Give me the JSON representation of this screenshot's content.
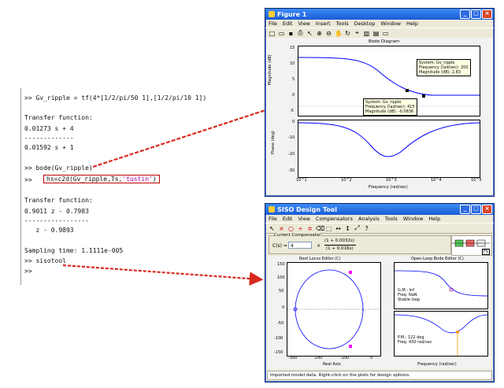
{
  "console": {
    "lines": [
      ">> Gv_ripple = tf(4*[1/2/pi/50 1],[1/2/pi/10 1])",
      "Transfer function:",
      "0.01273 s + 4",
      "-------------",
      "0.01592 s + 1",
      ">> bode(Gv_ripple)",
      ">> hs=c2d(Gv_ripple,Ts,'tustin')",
      "Transfer function:",
      "0.9011 z - 0.7983",
      "-----------------",
      "   z - 0.9893",
      "Sampling time: 1.1111e-005",
      ">> sisotool",
      ">>"
    ],
    "hs_cmd_prefix": "hs=c2d(Gv_ripple,Ts,",
    "hs_cmd_method": "'tustin'",
    "hs_cmd_suffix": ")"
  },
  "figure1": {
    "title": "Figure 1",
    "menu": [
      "File",
      "Edit",
      "View",
      "Insert",
      "Tools",
      "Desktop",
      "Window",
      "Help"
    ],
    "plot_title": "Bode Diagram",
    "ylabel_mag": "Magnitude (dB)",
    "ylabel_phase": "Phase (deg)",
    "xlabel": "Frequency (rad/sec)",
    "mag_ticks": [
      "15",
      "10",
      "5",
      "0",
      "-5"
    ],
    "phase_ticks": [
      "0",
      "-10",
      "-20",
      "-30"
    ],
    "x_ticks": [
      "10^1",
      "10^2",
      "10^3",
      "10^4",
      "10^5"
    ],
    "tip1": "System: Gv_ripple\nFrequency (rad/sec): 200\nMagnitude (dB): 2.83",
    "tip2": "System: Gv_ripple\nFrequency (rad/sec): 415\nMagnitude (dB): -0.0836"
  },
  "siso": {
    "title": "SISO Design Tool",
    "menu": [
      "File",
      "Edit",
      "View",
      "Compensators",
      "Analysis",
      "Tools",
      "Window",
      "Help"
    ],
    "current_comp_label": "Current Compensator",
    "cs_label": "C(s) =",
    "cs_gain": "4",
    "cs_num": "(1 + 0.0032s)",
    "cs_den": "(1 + 0.016s)",
    "root_locus_title": "Root Locus Editor (C)",
    "bode_title": "Open-Loop Bode Editor (C)",
    "rl_xlabel": "Real Axis",
    "rl_yticks": [
      "150",
      "100",
      "50",
      "0",
      "-50",
      "-100",
      "-150"
    ],
    "rl_xticks": [
      "-300",
      "-200",
      "-100",
      "0"
    ],
    "bode_xlabel": "Frequency (rad/sec)",
    "gm_text": "G.M.: Inf\nFreq: NaN\nStable loop",
    "pm_text": "P.M.: 122 deg\nFreq: 430 rad/sec",
    "status": "Imported model data. Right-click on the plots for design options.",
    "fs_label": "FS"
  },
  "colors": {
    "accent_red": "#d9281e",
    "curve_blue": "#0000ff",
    "pole_magenta": "#ff00ff"
  }
}
